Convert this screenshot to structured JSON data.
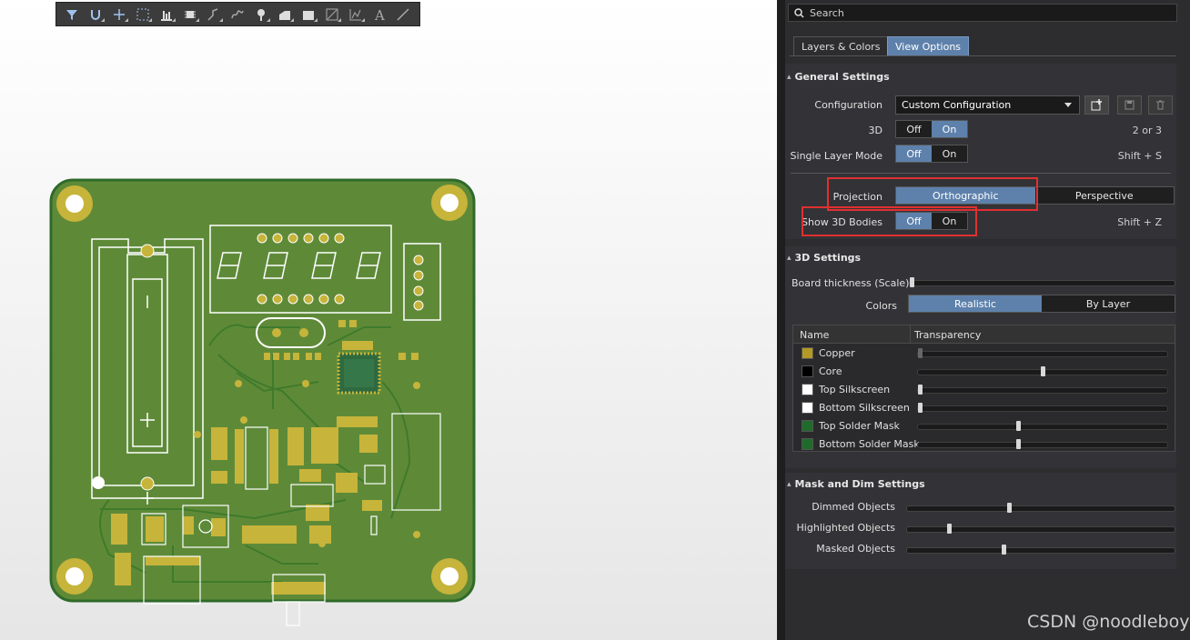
{
  "toolbar": {
    "tools": [
      "filter-icon",
      "magnet-icon",
      "cross-icon",
      "select-rect-icon",
      "align-icon",
      "component-icon",
      "route-icon",
      "interactive-route-icon",
      "via-icon",
      "fill-icon",
      "polygon-icon",
      "region-icon",
      "graph-icon",
      "text-icon",
      "line-icon"
    ]
  },
  "panel": {
    "search_placeholder": "Search",
    "tabs": [
      "Layers & Colors",
      "View Options"
    ],
    "general": {
      "title": "General Settings",
      "configuration_label": "Configuration",
      "configuration_value": "Custom Configuration",
      "three_d_label": "3D",
      "three_d_options": [
        "Off",
        "On"
      ],
      "three_d_shortcut": "2 or 3",
      "single_layer_label": "Single Layer Mode",
      "single_layer_options": [
        "Off",
        "On"
      ],
      "single_layer_shortcut": "Shift + S",
      "projection_label": "Projection",
      "projection_options": [
        "Orthographic",
        "Perspective"
      ],
      "show3d_label": "Show 3D Bodies",
      "show3d_options": [
        "Off",
        "On"
      ],
      "show3d_shortcut": "Shift + Z"
    },
    "settings3d": {
      "title": "3D Settings",
      "board_thickness_label": "Board thickness (Scale)",
      "board_thickness_level": 0.0,
      "colors_label": "Colors",
      "colors_options": [
        "Realistic",
        "By Layer"
      ],
      "table_header": [
        "Name",
        "Transparency"
      ],
      "rows": [
        {
          "name": "Copper",
          "color": "#b49a24",
          "level": 0.0
        },
        {
          "name": "Core",
          "color": "#000000",
          "level": 0.5
        },
        {
          "name": "Top Silkscreen",
          "color": "#ffffff",
          "level": 0.0
        },
        {
          "name": "Bottom Silkscreen",
          "color": "#ffffff",
          "level": 0.0
        },
        {
          "name": "Top Solder Mask",
          "color": "#1f6b2a",
          "level": 0.4
        },
        {
          "name": "Bottom Solder Mask",
          "color": "#1f6b2a",
          "level": 0.4
        }
      ]
    },
    "mask": {
      "title": "Mask and Dim Settings",
      "items": [
        {
          "label": "Dimmed Objects",
          "level": 0.38
        },
        {
          "label": "Highlighted Objects",
          "level": 0.15
        },
        {
          "label": "Masked Objects",
          "level": 0.36
        }
      ]
    }
  },
  "watermark": "CSDN @noodleboy",
  "colors": {
    "accent": "#5e81ac",
    "board": "#5e8a38",
    "copper": "#c2ac3c",
    "highlight": "#e03030"
  }
}
